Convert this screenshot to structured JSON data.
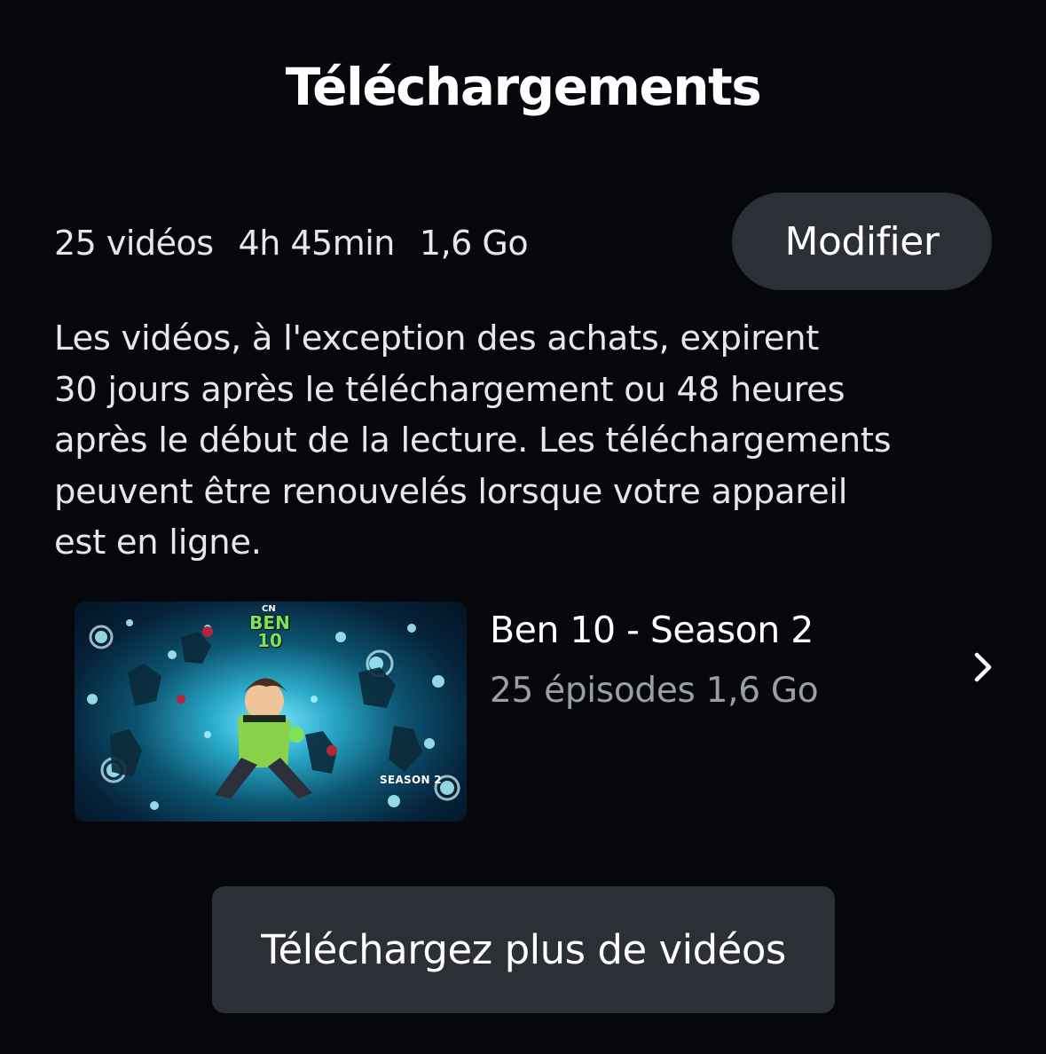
{
  "header": {
    "title": "Téléchargements"
  },
  "summary": {
    "video_count": "25 vidéos",
    "duration": "4h 45min",
    "size": "1,6 Go",
    "edit_label": "Modifier"
  },
  "notice": {
    "text": "Les vidéos, à l'exception des achats, expirent\n30 jours après le téléchargement ou 48 heures\naprès le début de la lecture. Les téléchargements\npeuvent être renouvelés lorsque votre appareil\nest en ligne."
  },
  "downloads": [
    {
      "title": "Ben 10 - Season 2",
      "meta": "25 épisodes 1,6 Go",
      "thumbnail_logo_brand": "CN",
      "thumbnail_logo_title": "BEN 10",
      "thumbnail_caption": "SEASON 2",
      "chevron_icon": "chevron-right-icon"
    }
  ],
  "footer": {
    "more_label": "Téléchargez plus de vidéos"
  },
  "colors": {
    "background": "#05070c",
    "button_bg": "#2c2f35",
    "primary_text": "#ffffff",
    "secondary_text": "#9b9ea5"
  }
}
